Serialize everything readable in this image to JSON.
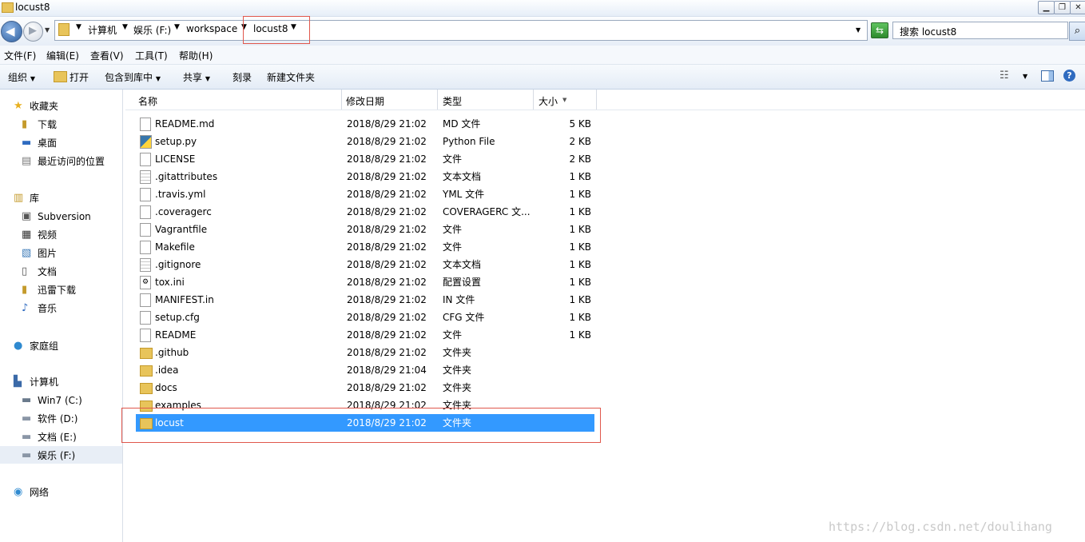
{
  "window": {
    "title": "locust8"
  },
  "breadcrumb": [
    "计算机",
    "娱乐 (F:)",
    "workspace",
    "locust8"
  ],
  "search": {
    "placeholder": "搜索 locust8"
  },
  "menu": [
    "文件(F)",
    "编辑(E)",
    "查看(V)",
    "工具(T)",
    "帮助(H)"
  ],
  "toolbar": {
    "organize": "组织",
    "open": "打开",
    "include": "包含到库中",
    "share": "共享",
    "burn": "刻录",
    "new_folder": "新建文件夹"
  },
  "nav": {
    "favorites": "收藏夹",
    "fav_items": [
      "下载",
      "桌面",
      "最近访问的位置"
    ],
    "libraries": "库",
    "lib_items": [
      "Subversion",
      "视频",
      "图片",
      "文档",
      "迅雷下载",
      "音乐"
    ],
    "homegroup": "家庭组",
    "computer": "计算机",
    "comp_items": [
      "Win7 (C:)",
      "软件 (D:)",
      "文档 (E:)",
      "娱乐 (F:)"
    ],
    "network": "网络"
  },
  "columns": {
    "name": "名称",
    "date": "修改日期",
    "type": "类型",
    "size": "大小"
  },
  "files": [
    {
      "name": "README.md",
      "date": "2018/8/29 21:02",
      "type": "MD 文件",
      "size": "5 KB",
      "kind": "file"
    },
    {
      "name": "setup.py",
      "date": "2018/8/29 21:02",
      "type": "Python File",
      "size": "2 KB",
      "kind": "python"
    },
    {
      "name": "LICENSE",
      "date": "2018/8/29 21:02",
      "type": "文件",
      "size": "2 KB",
      "kind": "file"
    },
    {
      "name": ".gitattributes",
      "date": "2018/8/29 21:02",
      "type": "文本文档",
      "size": "1 KB",
      "kind": "text"
    },
    {
      "name": ".travis.yml",
      "date": "2018/8/29 21:02",
      "type": "YML 文件",
      "size": "1 KB",
      "kind": "file"
    },
    {
      "name": ".coveragerc",
      "date": "2018/8/29 21:02",
      "type": "COVERAGERC 文...",
      "size": "1 KB",
      "kind": "file"
    },
    {
      "name": "Vagrantfile",
      "date": "2018/8/29 21:02",
      "type": "文件",
      "size": "1 KB",
      "kind": "file"
    },
    {
      "name": "Makefile",
      "date": "2018/8/29 21:02",
      "type": "文件",
      "size": "1 KB",
      "kind": "file"
    },
    {
      "name": ".gitignore",
      "date": "2018/8/29 21:02",
      "type": "文本文档",
      "size": "1 KB",
      "kind": "text"
    },
    {
      "name": "tox.ini",
      "date": "2018/8/29 21:02",
      "type": "配置设置",
      "size": "1 KB",
      "kind": "config"
    },
    {
      "name": "MANIFEST.in",
      "date": "2018/8/29 21:02",
      "type": "IN 文件",
      "size": "1 KB",
      "kind": "file"
    },
    {
      "name": "setup.cfg",
      "date": "2018/8/29 21:02",
      "type": "CFG 文件",
      "size": "1 KB",
      "kind": "file"
    },
    {
      "name": "README",
      "date": "2018/8/29 21:02",
      "type": "文件",
      "size": "1 KB",
      "kind": "file"
    },
    {
      "name": ".github",
      "date": "2018/8/29 21:02",
      "type": "文件夹",
      "size": "",
      "kind": "folder"
    },
    {
      "name": ".idea",
      "date": "2018/8/29 21:04",
      "type": "文件夹",
      "size": "",
      "kind": "folder"
    },
    {
      "name": "docs",
      "date": "2018/8/29 21:02",
      "type": "文件夹",
      "size": "",
      "kind": "folder"
    },
    {
      "name": "examples",
      "date": "2018/8/29 21:02",
      "type": "文件夹",
      "size": "",
      "kind": "folder"
    },
    {
      "name": "locust",
      "date": "2018/8/29 21:02",
      "type": "文件夹",
      "size": "",
      "kind": "folder",
      "selected": true
    }
  ],
  "watermark": "https://blog.csdn.net/doulihang"
}
